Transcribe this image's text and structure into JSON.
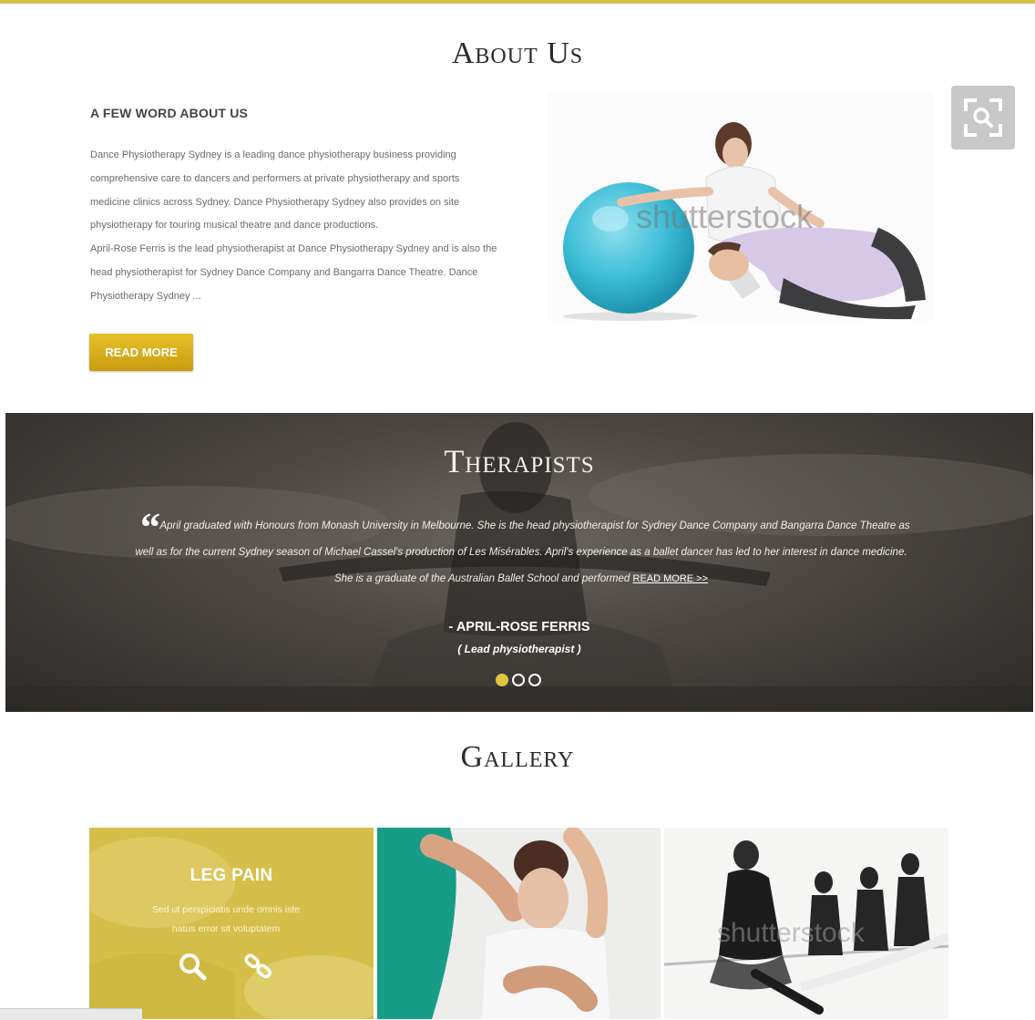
{
  "about": {
    "title": "About Us",
    "subtitle": "A FEW WORD ABOUT US",
    "paragraph1": "Dance Physiotherapy Sydney is a leading dance physiotherapy business providing comprehensive care to dancers and performers at private physiotherapy and sports medicine clinics across Sydney. Dance Physiotherapy Sydney also provides on site physiotherapy for touring musical theatre and dance productions.",
    "paragraph2": "April-Rose Ferris is the lead physiotherapist at Dance Physiotherapy Sydney and is also the head physiotherapist for Sydney Dance Company and Bangarra Dance Theatre. Dance Physiotherapy Sydney ...",
    "button_label": "READ MORE",
    "watermark": "shutterstock"
  },
  "therapists": {
    "title": "Therapists",
    "quote": "April graduated with Honours from Monash University in Melbourne. She is the head physiotherapist for Sydney Dance Company and Bangarra Dance Theatre as  well as for the current Sydney season of Michael Cassel's production of Les Misérables.  April's experience as a ballet dancer has led to her interest in dance medicine. She is a graduate of the Australian Ballet School and performed ",
    "quote_link": "READ MORE >>",
    "name": "- APRIL-ROSE FERRIS",
    "role": "( Lead physiotherapist )",
    "slides": 3,
    "active_slide": 1
  },
  "gallery": {
    "title": "Gallery",
    "tiles": [
      {
        "label": "LEG PAIN",
        "desc": "Sed ut perspiciatis unde omnis iste natus error sit voluptatem"
      },
      {},
      {
        "watermark": "shutterstock"
      }
    ]
  },
  "icons": [
    "zoom-icon",
    "quote-icon",
    "search-icon",
    "link-icon"
  ],
  "colors": {
    "accent": "#d4c24a",
    "button": "#d9af1c",
    "dot_active": "#e0c443",
    "dark_band": "#3e3a36"
  }
}
